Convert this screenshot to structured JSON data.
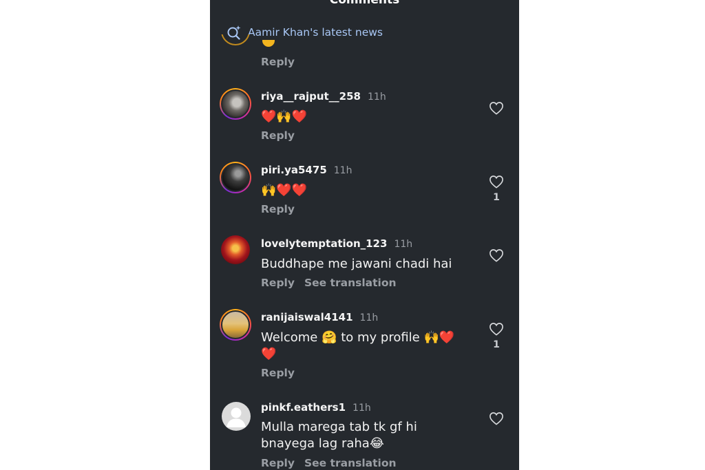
{
  "header": {
    "title": "Comments"
  },
  "search": {
    "label": "Aamir Khan's latest news",
    "icon": "search-sparkle-icon"
  },
  "partial_comment": {
    "reply_label": "Reply"
  },
  "comments": [
    {
      "username": "riya__rajput__258",
      "time": "11h",
      "text": "❤️🙌❤️",
      "reply_label": "Reply",
      "likes": ""
    },
    {
      "username": "piri.ya5475",
      "time": "11h",
      "text": "🙌❤️❤️",
      "reply_label": "Reply",
      "likes": "1"
    },
    {
      "username": "lovelytemptation_123",
      "time": "11h",
      "text": "Buddhape me jawani chadi hai",
      "reply_label": "Reply",
      "translate_label": "See translation",
      "likes": ""
    },
    {
      "username": "ranijaiswal4141",
      "time": "11h",
      "text_line1": "Welcome 🤗 to my profile 🙌❤️",
      "text_line2": "❤️",
      "reply_label": "Reply",
      "likes": "1"
    },
    {
      "username": "pinkf.eathers1",
      "time": "11h",
      "text_line1": "Mulla marega tab tk gf hi",
      "text_line2": "bnayega lag raha😂",
      "reply_label": "Reply",
      "translate_label": "See translation",
      "likes": ""
    }
  ],
  "colors": {
    "background": "#25292e",
    "accent_link": "#a9c7f5",
    "muted": "#9a9ea4"
  }
}
